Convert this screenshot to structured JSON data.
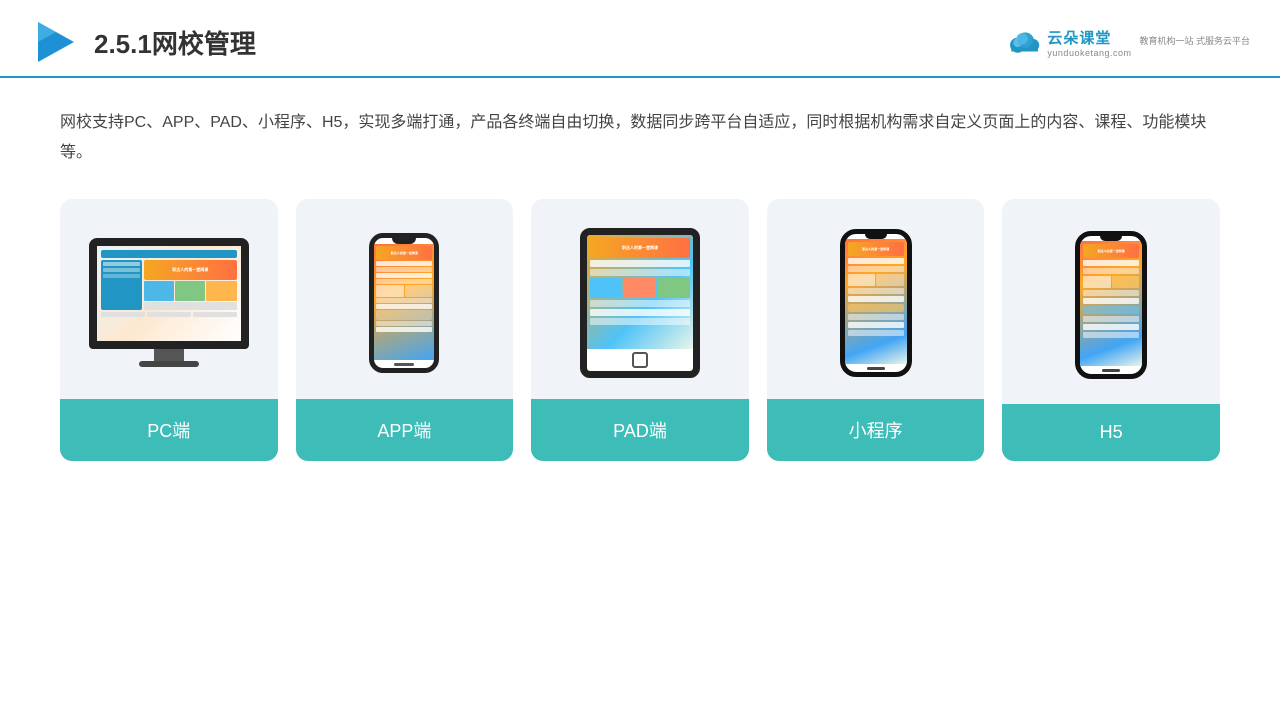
{
  "header": {
    "title": "2.5.1网校管理",
    "brand_cn": "云朵课堂",
    "brand_en": "yunduoketang.com",
    "brand_slogan": "教育机构一站\n式服务云平台"
  },
  "description": "网校支持PC、APP、PAD、小程序、H5，实现多端打通，产品各终端自由切换，数据同步跨平台自适应，同时根据机构需求自定义页面上的内容、课程、功能模块等。",
  "cards": [
    {
      "id": "pc",
      "label": "PC端"
    },
    {
      "id": "app",
      "label": "APP端"
    },
    {
      "id": "pad",
      "label": "PAD端"
    },
    {
      "id": "miniprogram",
      "label": "小程序"
    },
    {
      "id": "h5",
      "label": "H5"
    }
  ],
  "colors": {
    "accent": "#3dbcb8",
    "header_line": "#2196c4",
    "card_bg": "#eef2f7"
  }
}
